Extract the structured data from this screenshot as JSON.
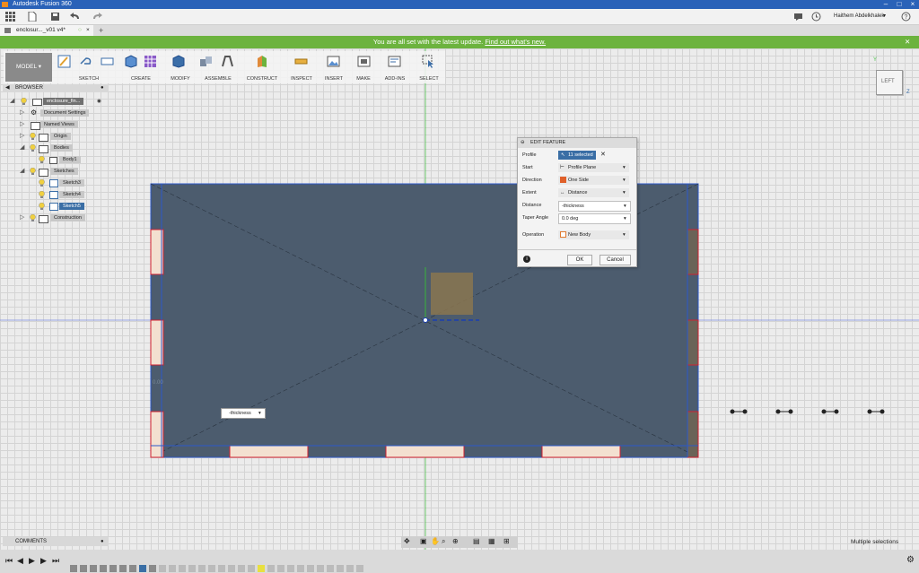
{
  "app": {
    "title": "Autodesk Fusion 360"
  },
  "quick_access": {
    "user_name": "Haithem Abdelkhalek"
  },
  "document_tab": {
    "name": "enclosur..._v01 v4*"
  },
  "banner": {
    "message": "You are all set with the latest update.",
    "link": "Find out what's new."
  },
  "toolbar": {
    "workspace": "MODEL",
    "groups": [
      "SKETCH",
      "CREATE",
      "MODIFY",
      "ASSEMBLE",
      "CONSTRUCT",
      "INSPECT",
      "INSERT",
      "MAKE",
      "ADD-INS",
      "SELECT"
    ]
  },
  "browser": {
    "title": "BROWSER",
    "items": [
      {
        "label": "enclosure_fin...",
        "indent": 0
      },
      {
        "label": "Document Settings",
        "indent": 1
      },
      {
        "label": "Named Views",
        "indent": 1
      },
      {
        "label": "Origin",
        "indent": 1
      },
      {
        "label": "Bodies",
        "indent": 1
      },
      {
        "label": "Body1",
        "indent": 2
      },
      {
        "label": "Sketches",
        "indent": 1
      },
      {
        "label": "Sketch3",
        "indent": 2
      },
      {
        "label": "Sketch4",
        "indent": 2
      },
      {
        "label": "Sketch5",
        "indent": 2
      },
      {
        "label": "Construction",
        "indent": 1
      }
    ]
  },
  "comments": {
    "title": "COMMENTS"
  },
  "viewcube": {
    "label": "LEFT",
    "axis_z": "Z",
    "axis_y": "Y"
  },
  "dialog": {
    "title": "EDIT FEATURE",
    "profile_label": "Profile",
    "profile_value": "11 selected",
    "start_label": "Start",
    "start_value": "Profile Plane",
    "direction_label": "Direction",
    "direction_value": "One Side",
    "extent_label": "Extent",
    "extent_value": "Distance",
    "distance_label": "Distance",
    "distance_value": "-thickness",
    "taper_label": "Taper Angle",
    "taper_value": "0.0 deg",
    "operation_label": "Operation",
    "operation_value": "New Body",
    "ok": "OK",
    "cancel": "Cancel"
  },
  "canvas": {
    "distance_input": "-thickness",
    "dim_text": "0.00"
  },
  "status": {
    "selection": "Multiple selections"
  },
  "colors": {
    "accent": "#2a62b8",
    "banner": "#6cb33e",
    "body": "#4a5a6a",
    "highlight": "#3a6ea5"
  }
}
